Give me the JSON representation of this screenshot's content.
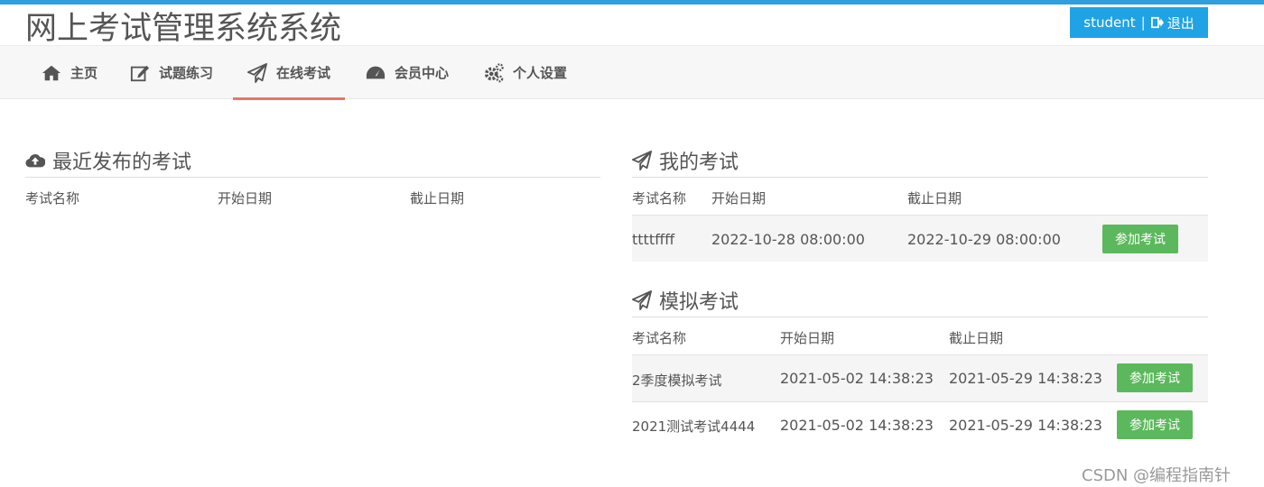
{
  "app": {
    "title": "网上考试管理系统系统"
  },
  "user": {
    "name": "student",
    "separator": "|",
    "logout_label": "退出"
  },
  "nav": {
    "items": [
      {
        "label": "主页",
        "icon": "home-icon"
      },
      {
        "label": "试题练习",
        "icon": "edit-icon"
      },
      {
        "label": "在线考试",
        "icon": "paper-plane-icon",
        "active": true
      },
      {
        "label": "会员中心",
        "icon": "dashboard-icon"
      },
      {
        "label": "个人设置",
        "icon": "gears-icon"
      }
    ]
  },
  "recent": {
    "title": "最近发布的考试",
    "headers": [
      "考试名称",
      "开始日期",
      "截止日期"
    ],
    "rows": []
  },
  "my_exams": {
    "title": "我的考试",
    "headers": [
      "考试名称",
      "开始日期",
      "截止日期"
    ],
    "rows": [
      {
        "name": "ttttffff",
        "start": "2022-10-28 08:00:00",
        "end": "2022-10-29 08:00:00",
        "action": "参加考试"
      }
    ]
  },
  "mock_exams": {
    "title": "模拟考试",
    "headers": [
      "考试名称",
      "开始日期",
      "截止日期"
    ],
    "rows": [
      {
        "name": "2季度模拟考试",
        "start": "2021-05-02 14:38:23",
        "end": "2021-05-29 14:38:23",
        "action": "参加考试"
      },
      {
        "name": "2021测试考试4444",
        "start": "2021-05-02 14:38:23",
        "end": "2021-05-29 14:38:23",
        "action": "参加考试"
      }
    ]
  },
  "watermark": "CSDN @编程指南针"
}
